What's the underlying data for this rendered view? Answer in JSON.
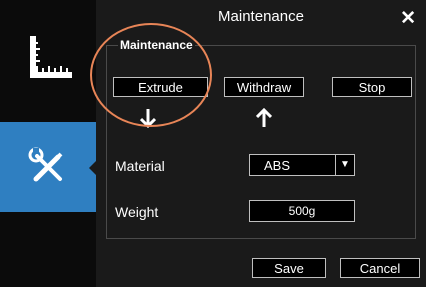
{
  "window": {
    "title": "Maintenance",
    "close_icon": "close-icon"
  },
  "sidebar": {
    "items": [
      {
        "icon": "ruler-icon",
        "active": false
      },
      {
        "icon": "tools-icon",
        "active": true
      }
    ],
    "active_color": "#2f7fc1"
  },
  "maintenance": {
    "group_label": "Maintenance",
    "buttons": {
      "extrude": "Extrude",
      "withdraw": "Withdraw",
      "stop": "Stop"
    },
    "arrows": {
      "extrude": "arrow-down-icon",
      "withdraw": "arrow-up-icon"
    }
  },
  "material": {
    "label": "Material",
    "selected": "ABS"
  },
  "weight": {
    "label": "Weight",
    "value": "500g"
  },
  "footer": {
    "save": "Save",
    "cancel": "Cancel"
  },
  "highlight_color": "#e88557"
}
